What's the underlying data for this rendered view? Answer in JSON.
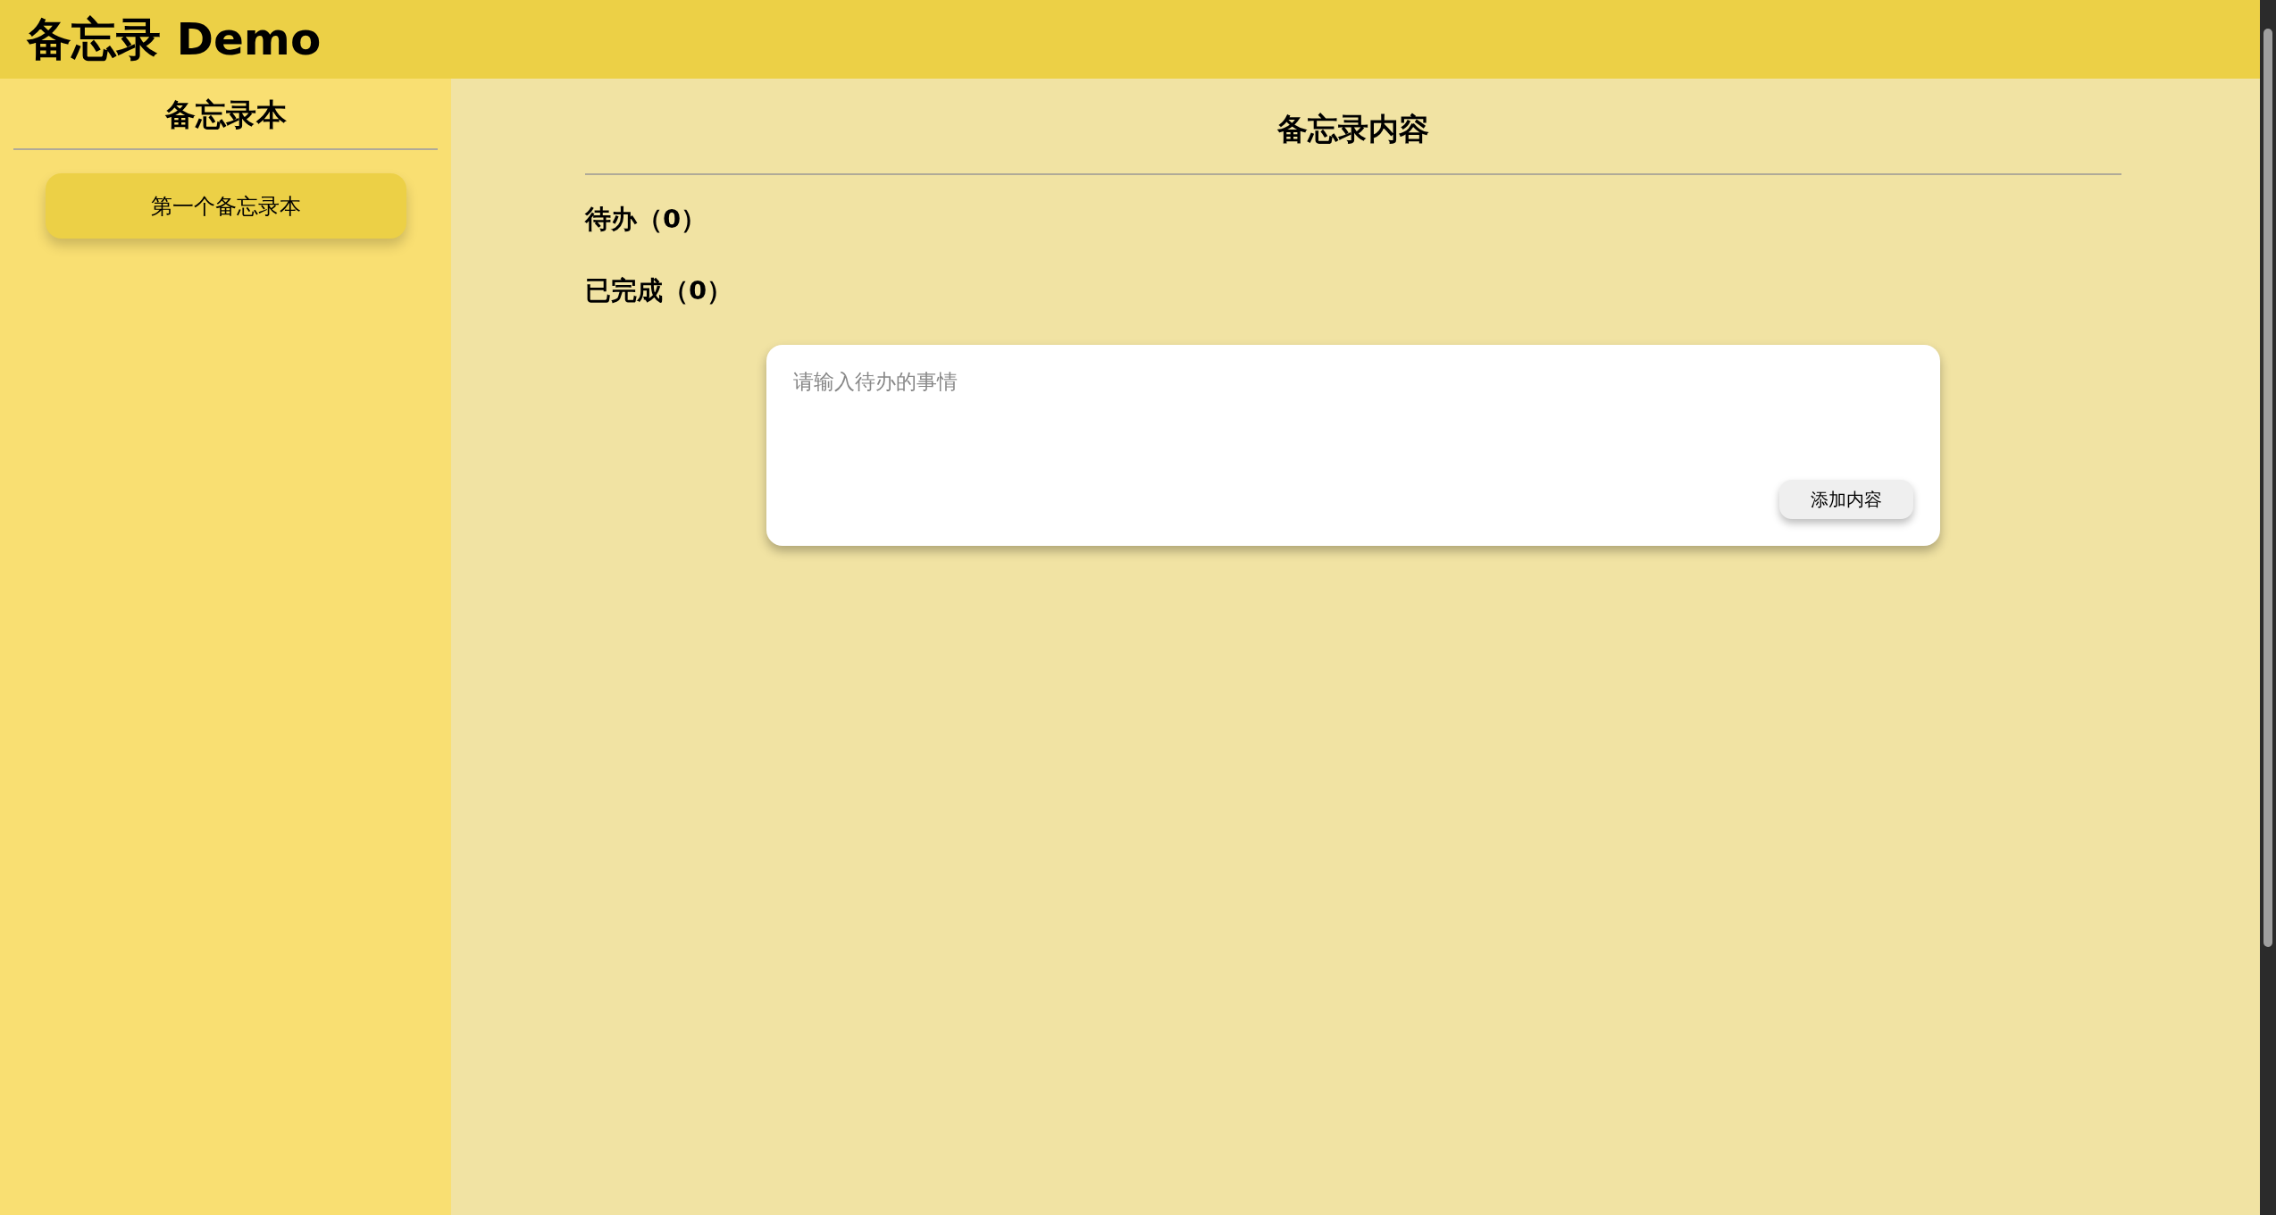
{
  "header": {
    "title": "备忘录 Demo"
  },
  "sidebar": {
    "title": "备忘录本",
    "items": [
      {
        "label": "第一个备忘录本",
        "selected": true
      }
    ]
  },
  "main": {
    "title": "备忘录内容",
    "sections": [
      {
        "label": "待办（0）"
      },
      {
        "label": "已完成（0）"
      }
    ],
    "editor": {
      "placeholder": "请输入待办的事情",
      "button": "添加内容"
    }
  }
}
